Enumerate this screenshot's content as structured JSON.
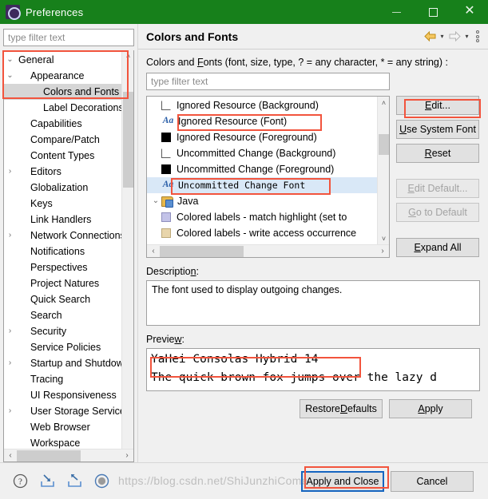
{
  "window": {
    "title": "Preferences",
    "icon": "gear-icon",
    "titlebar_color": "#17801b",
    "controls": {
      "minimize": "–",
      "maximize": "□",
      "close": "✕"
    }
  },
  "sidebar": {
    "filter_placeholder": "type filter text",
    "items": [
      {
        "label": "General",
        "indent": 1,
        "twisty": "⌄",
        "selected": false
      },
      {
        "label": "Appearance",
        "indent": 2,
        "twisty": "⌄",
        "selected": false
      },
      {
        "label": "Colors and Fonts",
        "indent": 3,
        "twisty": "",
        "selected": true
      },
      {
        "label": "Label Decorations",
        "indent": 3,
        "twisty": "",
        "selected": false
      },
      {
        "label": "Capabilities",
        "indent": 2,
        "twisty": "",
        "selected": false
      },
      {
        "label": "Compare/Patch",
        "indent": 2,
        "twisty": "",
        "selected": false
      },
      {
        "label": "Content Types",
        "indent": 2,
        "twisty": "",
        "selected": false
      },
      {
        "label": "Editors",
        "indent": 2,
        "twisty": "›",
        "selected": false
      },
      {
        "label": "Globalization",
        "indent": 2,
        "twisty": "",
        "selected": false
      },
      {
        "label": "Keys",
        "indent": 2,
        "twisty": "",
        "selected": false
      },
      {
        "label": "Link Handlers",
        "indent": 2,
        "twisty": "",
        "selected": false
      },
      {
        "label": "Network Connections",
        "indent": 2,
        "twisty": "›",
        "selected": false
      },
      {
        "label": "Notifications",
        "indent": 2,
        "twisty": "",
        "selected": false
      },
      {
        "label": "Perspectives",
        "indent": 2,
        "twisty": "",
        "selected": false
      },
      {
        "label": "Project Natures",
        "indent": 2,
        "twisty": "",
        "selected": false
      },
      {
        "label": "Quick Search",
        "indent": 2,
        "twisty": "",
        "selected": false
      },
      {
        "label": "Search",
        "indent": 2,
        "twisty": "",
        "selected": false
      },
      {
        "label": "Security",
        "indent": 2,
        "twisty": "›",
        "selected": false
      },
      {
        "label": "Service Policies",
        "indent": 2,
        "twisty": "",
        "selected": false
      },
      {
        "label": "Startup and Shutdown",
        "indent": 2,
        "twisty": "›",
        "selected": false
      },
      {
        "label": "Tracing",
        "indent": 2,
        "twisty": "",
        "selected": false
      },
      {
        "label": "UI Responsiveness",
        "indent": 2,
        "twisty": "",
        "selected": false
      },
      {
        "label": "User Storage Service",
        "indent": 2,
        "twisty": "›",
        "selected": false
      },
      {
        "label": "Web Browser",
        "indent": 2,
        "twisty": "",
        "selected": false
      },
      {
        "label": "Workspace",
        "indent": 2,
        "twisty": "",
        "selected": false
      }
    ],
    "scroll_up": "˄",
    "scroll_down": "˅",
    "scroll_left": "‹",
    "scroll_right": "›"
  },
  "header": {
    "title": "Colors and Fonts",
    "back_icon": "back-arrow-icon",
    "forward_icon": "forward-arrow-icon",
    "caret": "▾",
    "menu_icon": "view-menu-icon"
  },
  "main": {
    "filter_label_pre": "Colors and ",
    "filter_label_underline": "F",
    "filter_label_post": "onts (font, size, type, ? = any character, * = any string) :",
    "filter_placeholder": "type filter text",
    "list": [
      {
        "label": "Ignored Resource (Background)",
        "icon": "swatch-white",
        "indent": 1,
        "selected": false,
        "mono": false,
        "twisty": ""
      },
      {
        "label": "Ignored Resource (Font)",
        "icon": "font-aa",
        "indent": 1,
        "selected": false,
        "mono": false,
        "twisty": ""
      },
      {
        "label": "Ignored Resource (Foreground)",
        "icon": "swatch-black",
        "indent": 1,
        "selected": false,
        "mono": false,
        "twisty": ""
      },
      {
        "label": "Uncommitted Change (Background)",
        "icon": "swatch-white",
        "indent": 1,
        "selected": false,
        "mono": false,
        "twisty": ""
      },
      {
        "label": "Uncommitted Change (Foreground)",
        "icon": "swatch-black",
        "indent": 1,
        "selected": false,
        "mono": false,
        "twisty": ""
      },
      {
        "label": "Uncommitted Change Font",
        "icon": "font-aa",
        "indent": 1,
        "selected": true,
        "mono": true,
        "twisty": ""
      },
      {
        "label": "Java",
        "icon": "java-folder",
        "indent": 0,
        "selected": false,
        "mono": false,
        "twisty": "⌄"
      },
      {
        "label": "Colored labels - match highlight (set to ",
        "icon": "swatch-lav",
        "indent": 1,
        "selected": false,
        "mono": false,
        "twisty": ""
      },
      {
        "label": "Colored labels - write access occurrence",
        "icon": "swatch-tan",
        "indent": 1,
        "selected": false,
        "mono": false,
        "twisty": ""
      }
    ],
    "buttons": [
      {
        "label_pre": "",
        "underline": "E",
        "label_post": "dit...",
        "enabled": true,
        "name": "edit-button"
      },
      {
        "label_pre": "",
        "underline": "U",
        "label_post": "se System Font",
        "enabled": true,
        "name": "use-system-font-button"
      },
      {
        "label_pre": "",
        "underline": "R",
        "label_post": "eset",
        "enabled": true,
        "name": "reset-button"
      },
      {
        "label_pre": "",
        "underline": "E",
        "label_post": "dit Default...",
        "enabled": false,
        "name": "edit-default-button"
      },
      {
        "label_pre": "",
        "underline": "G",
        "label_post": "o to Default",
        "enabled": false,
        "name": "go-to-default-button"
      },
      {
        "label_pre": "",
        "underline": "E",
        "label_post": "xpand All",
        "enabled": true,
        "name": "expand-all-button"
      }
    ],
    "description_label_pre": "Descriptio",
    "description_label_underline": "n",
    "description_label_post": ":",
    "description_text": "The font used to display outgoing changes.",
    "preview_label_pre": "Previe",
    "preview_label_underline": "w",
    "preview_label_post": ":",
    "preview_line1": "YaHei Consolas Hybrid 14",
    "preview_line2": "The quick brown fox jumps over the lazy d",
    "restore_defaults_pre": "Restore ",
    "restore_defaults_underline": "D",
    "restore_defaults_post": "efaults",
    "apply_pre": "",
    "apply_underline": "A",
    "apply_post": "pply"
  },
  "footer": {
    "help_icon": "help-icon",
    "import_icon": "import-icon",
    "export_icon": "export-icon",
    "record_icon": "record-icon",
    "apply_and_close": "Apply and Close",
    "cancel": "Cancel"
  },
  "watermark": "https://blog.csdn.net/ShiJunzhiCome"
}
